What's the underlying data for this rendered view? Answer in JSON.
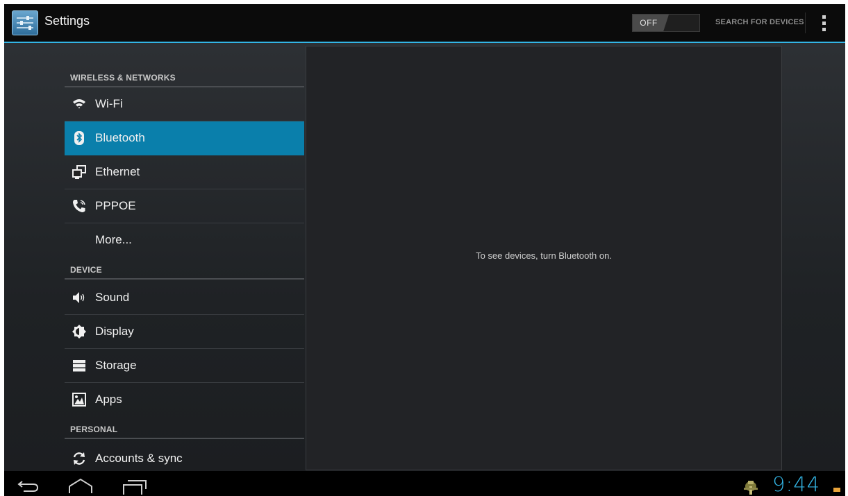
{
  "actionbar": {
    "title": "Settings",
    "app_icon": "settings-sliders-icon",
    "toggle_label": "OFF",
    "search_label": "SEARCH FOR DEVICES",
    "overflow_icon": "overflow-menu-icon",
    "accent_color": "#33b5e5"
  },
  "nav": {
    "sections": {
      "wireless": "WIRELESS & NETWORKS",
      "device": "DEVICE",
      "personal": "PERSONAL"
    },
    "items": [
      {
        "label": "Wi-Fi",
        "icon": "wifi-icon"
      },
      {
        "label": "Bluetooth",
        "icon": "bluetooth-icon",
        "selected": true
      },
      {
        "label": "Ethernet",
        "icon": "ethernet-icon"
      },
      {
        "label": "PPPOE",
        "icon": "phone-icon"
      },
      {
        "label": "More...",
        "icon": ""
      },
      {
        "label": "Sound",
        "icon": "speaker-icon"
      },
      {
        "label": "Display",
        "icon": "brightness-icon"
      },
      {
        "label": "Storage",
        "icon": "storage-icon"
      },
      {
        "label": "Apps",
        "icon": "apps-icon"
      },
      {
        "label": "Accounts & sync",
        "icon": "sync-icon"
      }
    ],
    "selected_color": "#0a7fab"
  },
  "detail": {
    "message": "To see devices, turn Bluetooth on."
  },
  "systembar": {
    "clock": "9:44",
    "back_icon": "back-icon",
    "home_icon": "home-icon",
    "recents_icon": "recents-icon",
    "notification_icon": "android-notification-icon"
  }
}
